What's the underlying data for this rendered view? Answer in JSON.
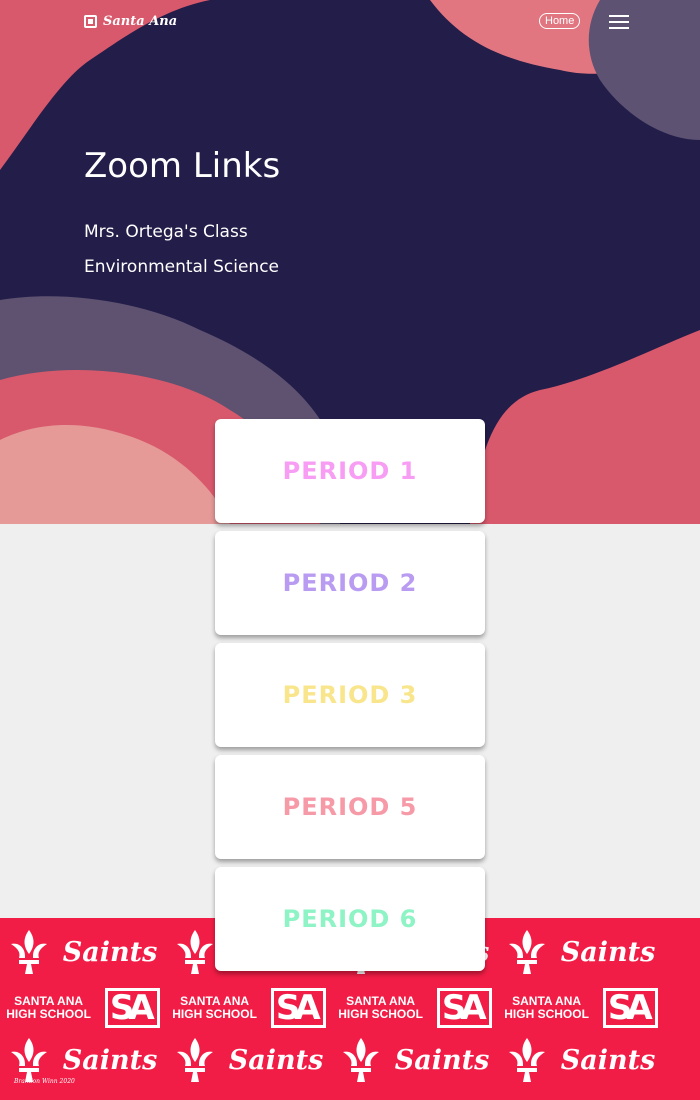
{
  "header": {
    "logo_text": "Santa Ana",
    "home_label": "Home",
    "menu_icon": "hamburger-icon"
  },
  "hero": {
    "title": "Zoom Links",
    "teacher": "Mrs. Ortega's Class",
    "course": "Environmental Science"
  },
  "periods": [
    {
      "label": "PERIOD 1",
      "color": "#f79ef4"
    },
    {
      "label": "PERIOD 2",
      "color": "#b99cf1"
    },
    {
      "label": "PERIOD 3",
      "color": "#f9e58c"
    },
    {
      "label": "PERIOD 5",
      "color": "#f79aa8"
    },
    {
      "label": "PERIOD 6",
      "color": "#8ef3c5"
    }
  ],
  "footer": {
    "saints": "Saints",
    "school_line1": "SANTA ANA",
    "school_line2": "HIGH SCHOOL",
    "sa_mark": "SA",
    "credit": "Brandon Winn 2020",
    "background": "#f21d46"
  },
  "colors": {
    "navy": "#231d49",
    "coral": "#d9596c",
    "pink_light": "#e98a8f",
    "slate": "#5e5270"
  }
}
